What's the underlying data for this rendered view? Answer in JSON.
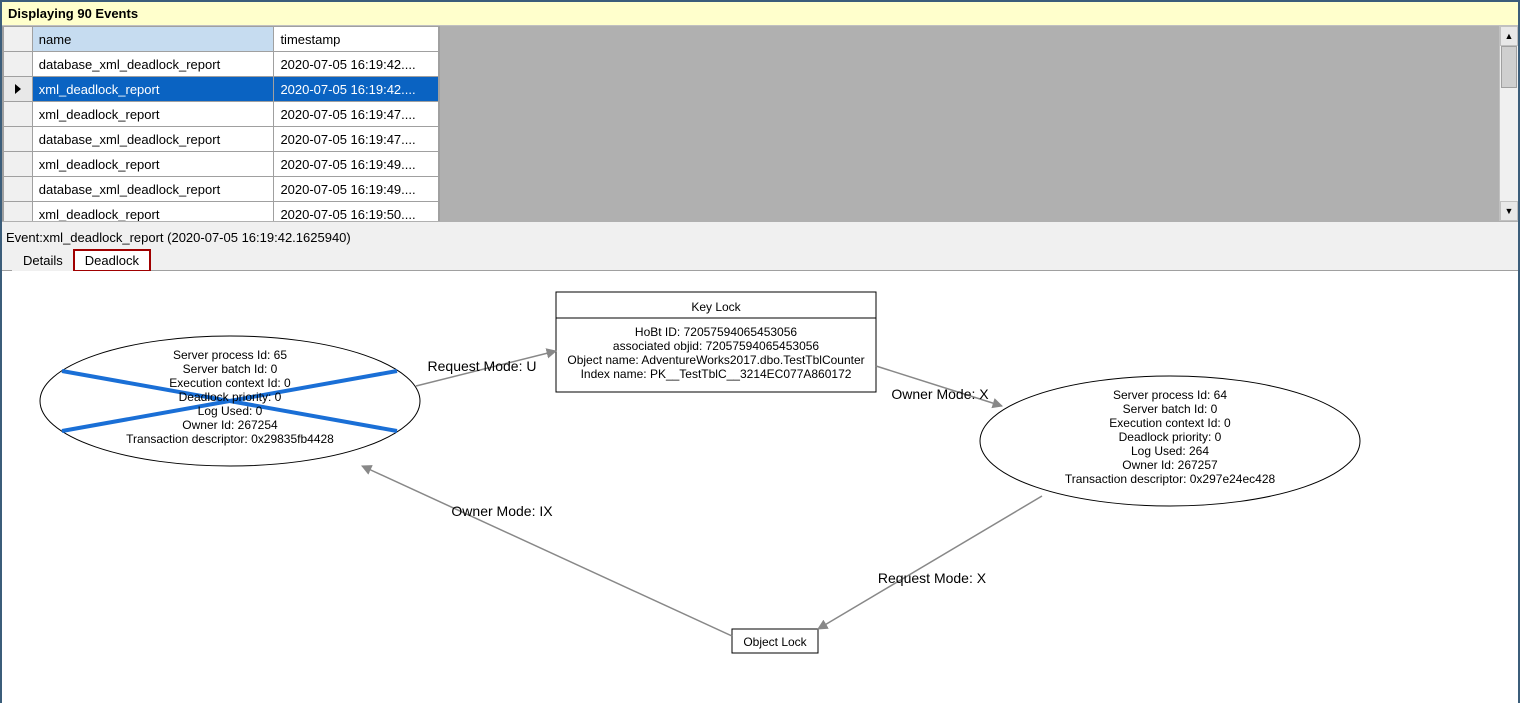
{
  "banner": {
    "text": "Displaying 90 Events"
  },
  "grid": {
    "columns": {
      "name": "name",
      "timestamp": "timestamp"
    },
    "selected_index": 1,
    "rows": [
      {
        "name": "database_xml_deadlock_report",
        "timestamp": "2020-07-05 16:19:42...."
      },
      {
        "name": "xml_deadlock_report",
        "timestamp": "2020-07-05 16:19:42...."
      },
      {
        "name": "xml_deadlock_report",
        "timestamp": "2020-07-05 16:19:47...."
      },
      {
        "name": "database_xml_deadlock_report",
        "timestamp": "2020-07-05 16:19:47...."
      },
      {
        "name": "xml_deadlock_report",
        "timestamp": "2020-07-05 16:19:49...."
      },
      {
        "name": "database_xml_deadlock_report",
        "timestamp": "2020-07-05 16:19:49...."
      },
      {
        "name": "xml_deadlock_report",
        "timestamp": "2020-07-05 16:19:50...."
      }
    ]
  },
  "detail": {
    "title": "Event:xml_deadlock_report (2020-07-05 16:19:42.1625940)",
    "tabs": {
      "details": "Details",
      "deadlock": "Deadlock"
    }
  },
  "graph": {
    "victim": {
      "lines": [
        "Server process Id: 65",
        "Server batch Id: 0",
        "Execution context Id: 0",
        "Deadlock priority: 0",
        "Log Used: 0",
        "Owner Id: 267254",
        "Transaction descriptor: 0x29835fb4428"
      ]
    },
    "survivor": {
      "lines": [
        "Server process Id: 64",
        "Server batch Id: 0",
        "Execution context Id: 0",
        "Deadlock priority: 0",
        "Log Used: 264",
        "Owner Id: 267257",
        "Transaction descriptor: 0x297e24ec428"
      ]
    },
    "keylock": {
      "title": "Key Lock",
      "lines": [
        "HoBt ID: 72057594065453056",
        "associated objid: 72057594065453056",
        "Object name: AdventureWorks2017.dbo.TestTblCounter",
        "Index name: PK__TestTblC__3214EC077A860172"
      ]
    },
    "objectlock": {
      "title": "Object Lock"
    },
    "edges": {
      "req_u": "Request Mode: U",
      "own_x": "Owner Mode: X",
      "own_ix": "Owner Mode: IX",
      "req_x": "Request Mode: X"
    }
  }
}
